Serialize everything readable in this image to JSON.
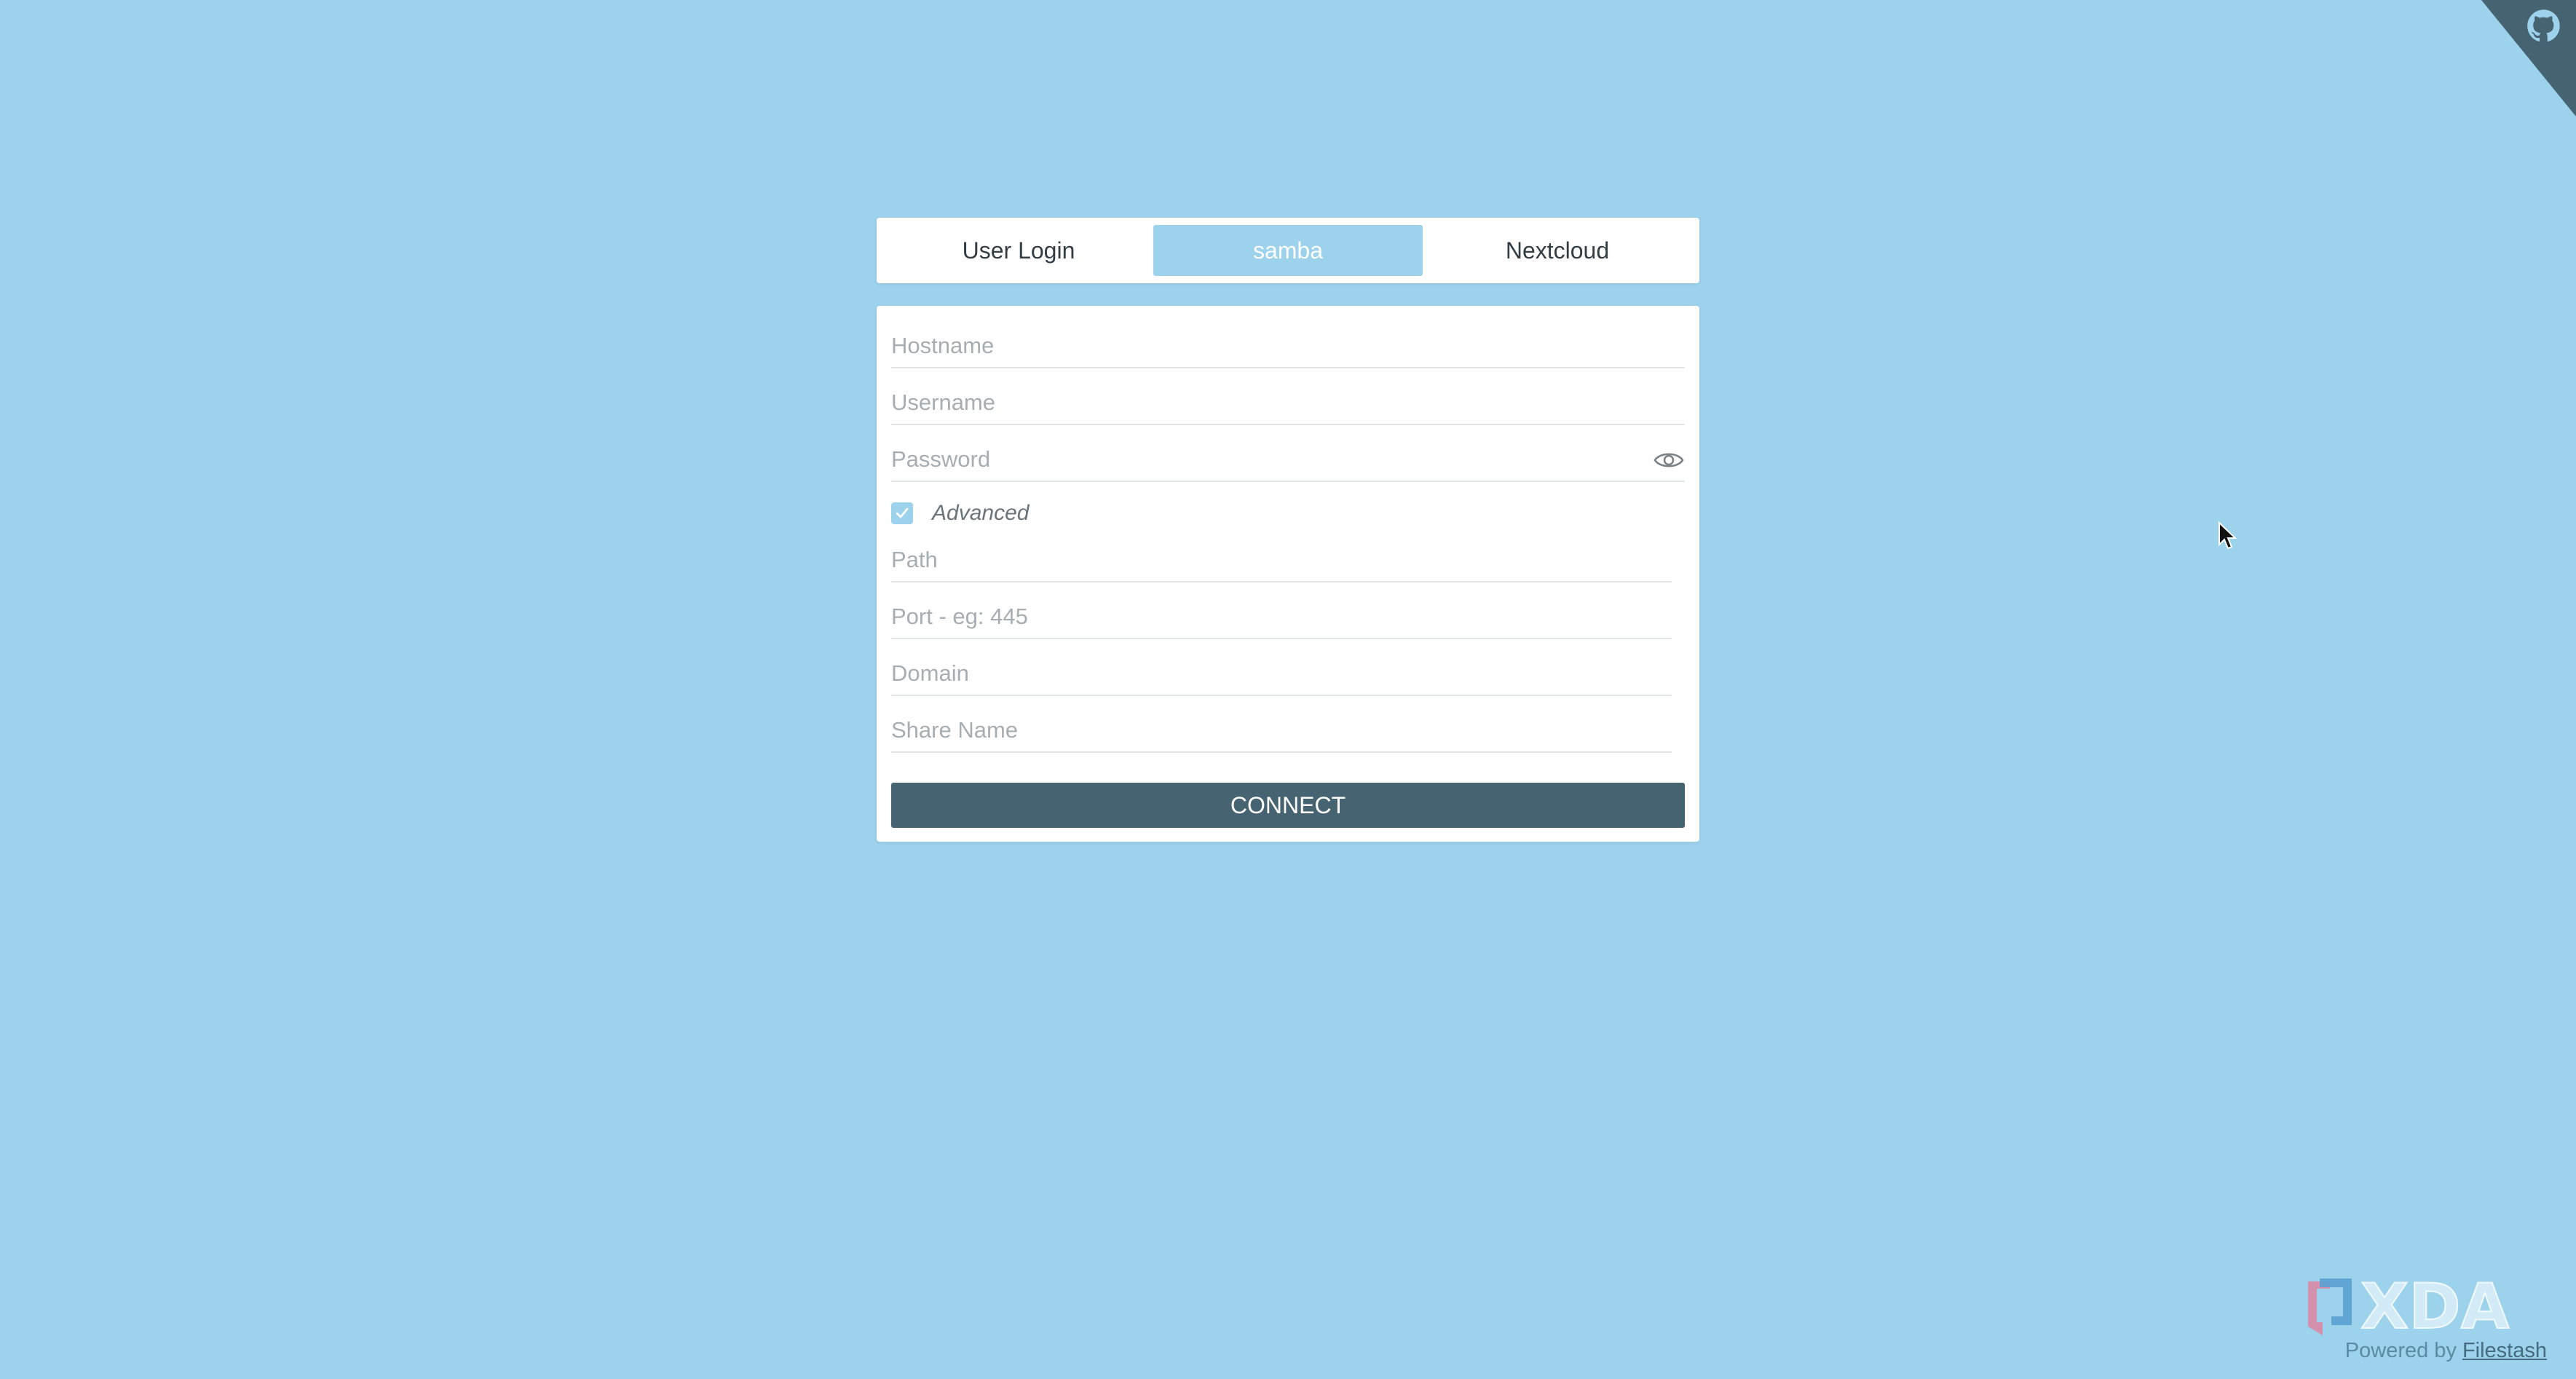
{
  "tabs": [
    {
      "label": "User Login",
      "active": false
    },
    {
      "label": "samba",
      "active": true
    },
    {
      "label": "Nextcloud",
      "active": false
    }
  ],
  "form": {
    "hostname_placeholder": "Hostname",
    "username_placeholder": "Username",
    "password_placeholder": "Password",
    "advanced_label": "Advanced",
    "advanced_checked": true,
    "path_placeholder": "Path",
    "port_placeholder": "Port - eg: 445",
    "domain_placeholder": "Domain",
    "share_placeholder": "Share Name",
    "connect_label": "CONNECT"
  },
  "footer": {
    "logo_text": "XDA",
    "powered_text": "Powered by",
    "powered_link": "Filestash"
  },
  "colors": {
    "background": "#9dd2ec",
    "button": "#466372",
    "corner": "#466372"
  },
  "icons": {
    "corner": "github-octocat-icon",
    "password_toggle": "eye-icon",
    "checkbox": "checkmark-icon"
  }
}
